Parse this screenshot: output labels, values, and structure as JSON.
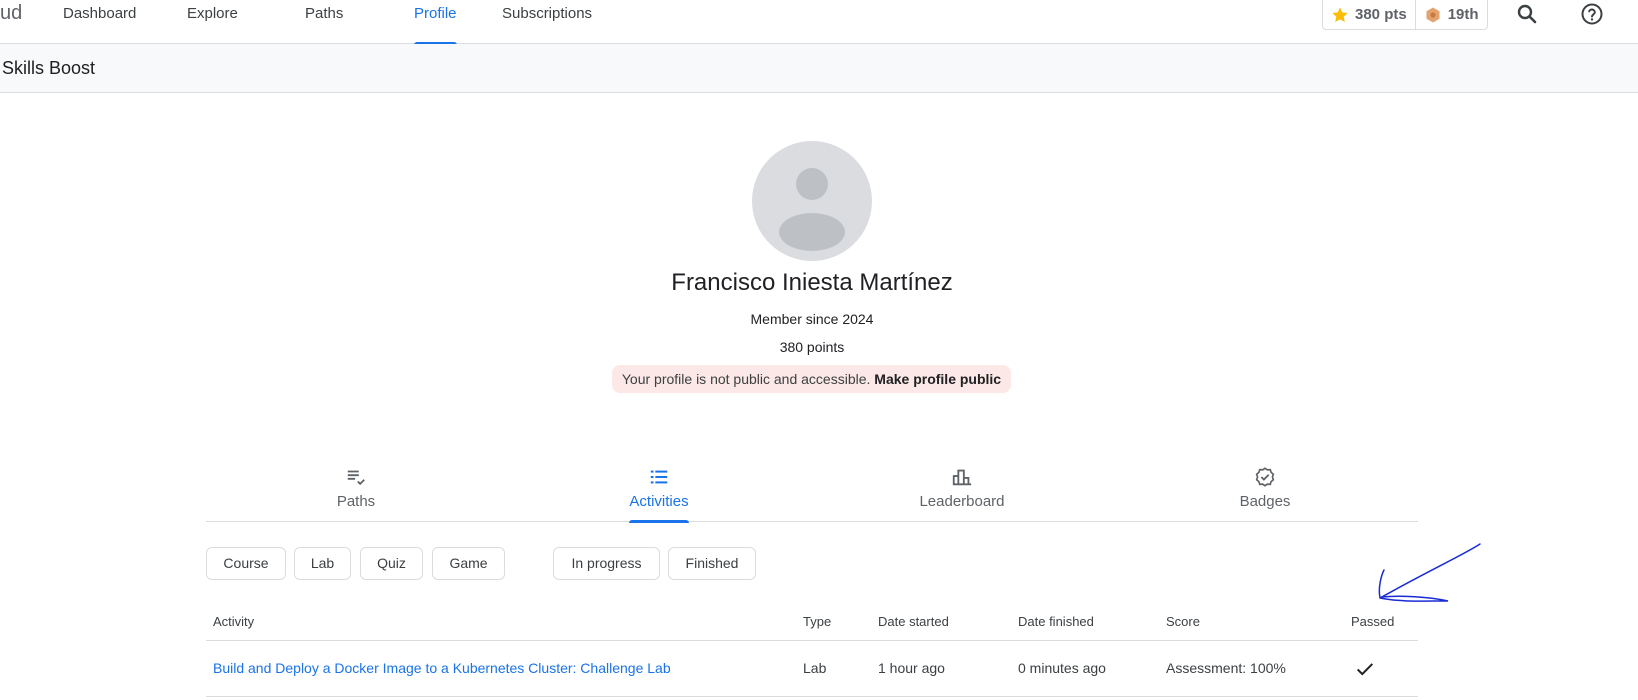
{
  "nav": {
    "brand_fragment": "ud",
    "items": [
      {
        "label": "Dashboard"
      },
      {
        "label": "Explore"
      },
      {
        "label": "Paths"
      },
      {
        "label": "Profile"
      },
      {
        "label": "Subscriptions"
      }
    ],
    "active": "Profile",
    "points": "380 pts",
    "rank": "19th",
    "icons": [
      "star-icon",
      "league-badge-icon",
      "search-icon",
      "help-icon"
    ],
    "accent_color": "#1a73e8"
  },
  "subheader": {
    "title": "Skills Boost"
  },
  "profile": {
    "name": "Francisco Iniesta Martínez",
    "member_since": "Member since 2024",
    "points": "380 points",
    "notice_text": "Your profile is not public and accessible.",
    "notice_link": "Make profile public"
  },
  "tabs": [
    {
      "label": "Paths",
      "icon": "playlist-check-icon"
    },
    {
      "label": "Activities",
      "icon": "list-icon"
    },
    {
      "label": "Leaderboard",
      "icon": "leaderboard-icon"
    },
    {
      "label": "Badges",
      "icon": "verified-badge-icon"
    }
  ],
  "active_tab": "Activities",
  "filters": {
    "type": [
      "Course",
      "Lab",
      "Quiz",
      "Game"
    ],
    "status": [
      "In progress",
      "Finished"
    ]
  },
  "table": {
    "columns": [
      "Activity",
      "Type",
      "Date started",
      "Date finished",
      "Score",
      "Passed"
    ],
    "rows": [
      {
        "activity": "Build and Deploy a Docker Image to a Kubernetes Cluster: Challenge Lab",
        "type": "Lab",
        "date_started": "1 hour ago",
        "date_finished": "0 minutes ago",
        "score": "Assessment: 100%",
        "passed": true
      }
    ]
  }
}
